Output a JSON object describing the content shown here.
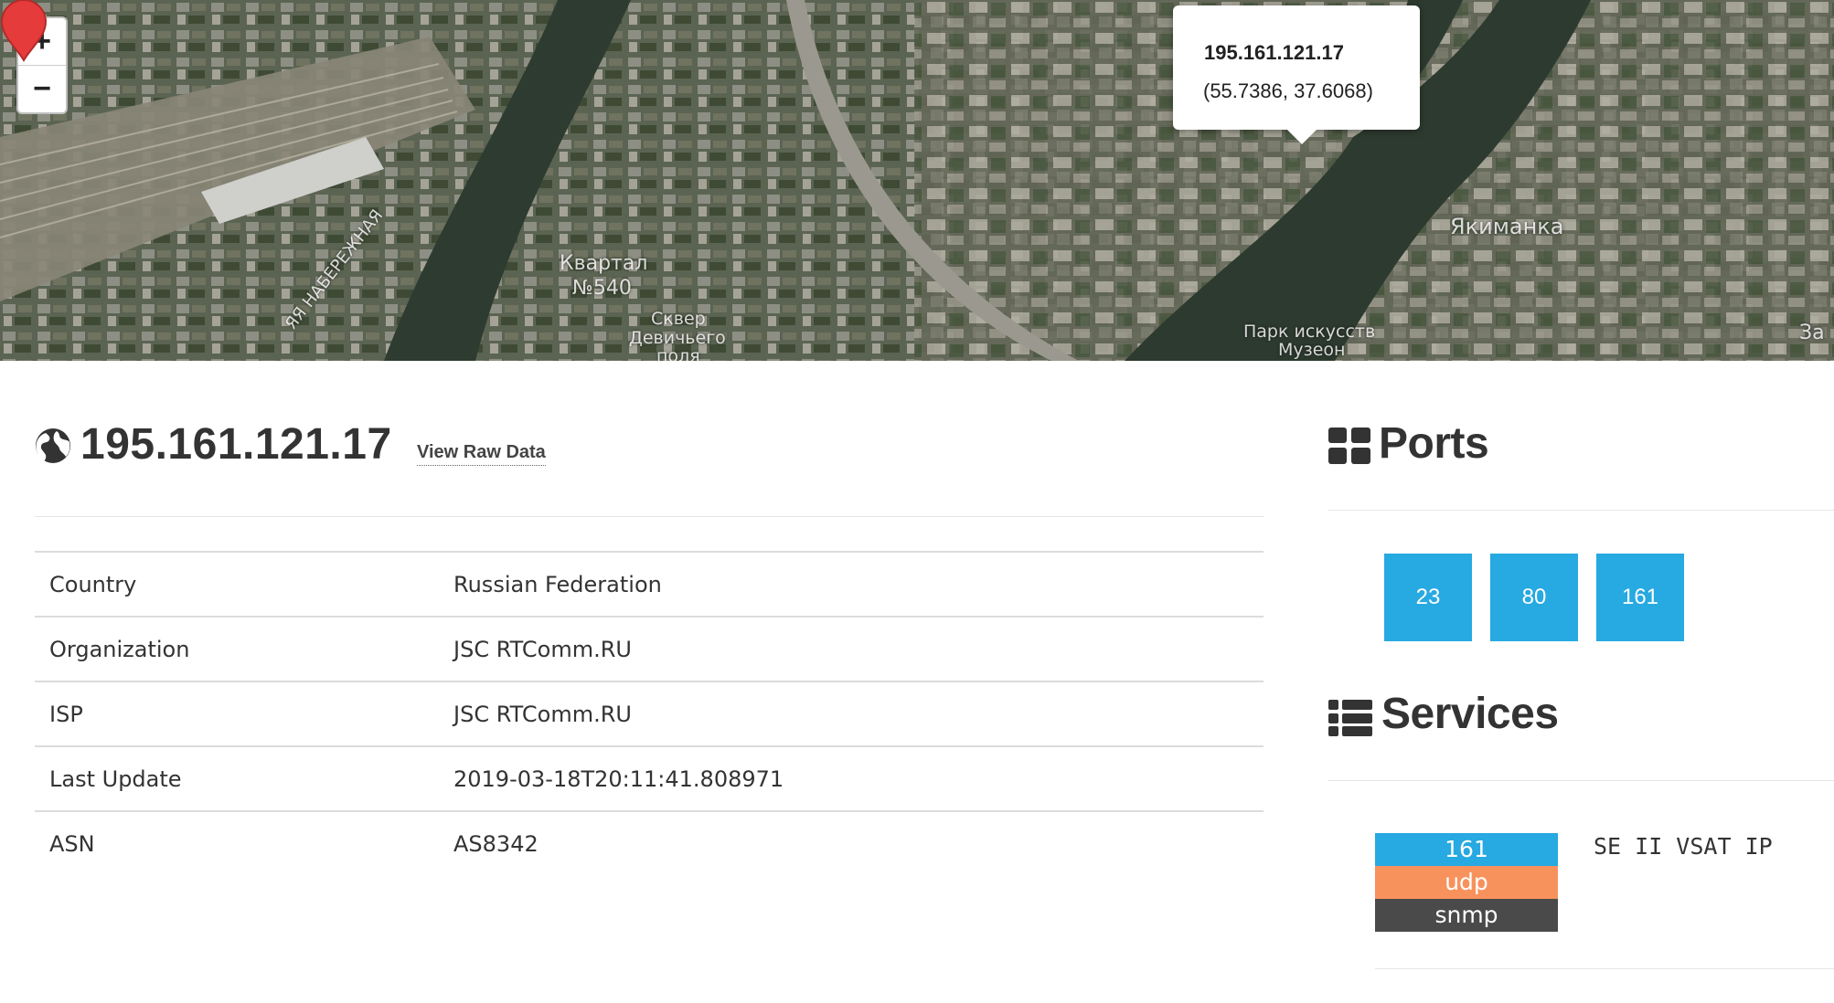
{
  "map": {
    "zoom_in": "+",
    "zoom_out": "−",
    "popup_ip": "195.161.121.17",
    "popup_coords": "(55.7386, 37.6068)",
    "labels": [
      "Квартал",
      "№540",
      "Сквер",
      "Девичьего",
      "поля",
      "ЯЯ НАБЕРЕЖНАЯ",
      "Якиманка",
      "Парк искусств",
      "Музеон",
      "Зa"
    ]
  },
  "host": {
    "ip": "195.161.121.17",
    "view_raw": "View Raw Data"
  },
  "info_rows": [
    {
      "key": "Country",
      "value": "Russian Federation"
    },
    {
      "key": "Organization",
      "value": "JSC RTComm.RU"
    },
    {
      "key": "ISP",
      "value": "JSC RTComm.RU"
    },
    {
      "key": "Last Update",
      "value": "2019-03-18T20:11:41.808971"
    },
    {
      "key": "ASN",
      "value": "AS8342"
    }
  ],
  "ports": {
    "title": "Ports",
    "items": [
      "23",
      "80",
      "161"
    ]
  },
  "services": {
    "title": "Services",
    "port": "161",
    "protocol": "udp",
    "name": "snmp",
    "banner": "SE II VSAT IP"
  },
  "colors": {
    "port_blue": "#27a9e1",
    "udp_orange": "#f8925c",
    "service_dark": "#4a4a4a",
    "marker_red": "#e63b3b"
  }
}
